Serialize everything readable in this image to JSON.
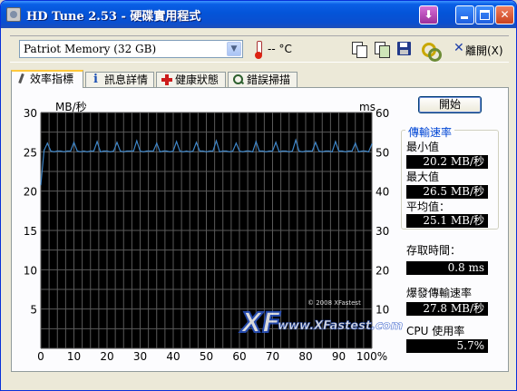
{
  "window": {
    "title": "HD Tune 2.53 - 硬碟實用程式",
    "minimize_label": "_",
    "maximize_label": "□",
    "close_label": "✕",
    "download_label": "⬇"
  },
  "toolbar": {
    "drive_selected": "Patriot Memory (32 GB)",
    "temperature": "-- °C",
    "exit_label": "離開(X)"
  },
  "tabs": [
    {
      "label": "效率指標",
      "icon": "benchmark-icon"
    },
    {
      "label": "訊息詳情",
      "icon": "info-icon"
    },
    {
      "label": "健康狀態",
      "icon": "health-cross-icon"
    },
    {
      "label": "錯誤掃描",
      "icon": "magnifier-icon"
    }
  ],
  "start_button": "開始",
  "transfer": {
    "group_label": "傳輸速率",
    "min_label": "最小值",
    "min_value": "20.2 MB/秒",
    "max_label": "最大值",
    "max_value": "26.5 MB/秒",
    "avg_label": "平均值：",
    "avg_value": "25.1 MB/秒"
  },
  "access_time": {
    "label": "存取時間：",
    "value": "0.8 ms"
  },
  "burst_rate": {
    "label": "爆發傳輸速率",
    "value": "27.8 MB/秒"
  },
  "cpu_usage": {
    "label": "CPU 使用率",
    "value": "5.7%"
  },
  "watermark": {
    "logo": "XF",
    "copyright": "© 2008 XFastest",
    "url": "www.XFastest.com"
  },
  "colors": {
    "chart_bg": "#000000",
    "grid": "#5a5a5a",
    "series": "#3f86c8",
    "accent_label": "#0046d5"
  },
  "chart_data": {
    "type": "line",
    "ylabel_left": "MB/秒",
    "ylabel_right": "ms",
    "ylim_left": [
      0,
      30
    ],
    "ylim_right": [
      0,
      60
    ],
    "yticks_left": [
      5,
      10,
      15,
      20,
      25,
      30
    ],
    "yticks_right": [
      10,
      20,
      30,
      40,
      50,
      60
    ],
    "xticks": [
      "0",
      "10",
      "20",
      "30",
      "40",
      "50",
      "60",
      "70",
      "80",
      "90",
      "100%"
    ],
    "xlim": [
      0,
      100
    ],
    "grid": true,
    "series": [
      {
        "values": [
          20.8,
          25.2,
          26.1,
          25.1,
          25.0,
          25.1,
          25.1,
          25.0,
          25.1,
          25.1,
          26.2,
          25.1,
          25.0,
          25.1,
          25.0,
          25.1,
          25.1,
          26.3,
          25.0,
          25.1,
          25.1,
          25.0,
          25.1,
          26.2,
          25.1,
          25.0,
          25.1,
          25.1,
          25.1,
          26.4,
          25.1,
          25.0,
          25.1,
          25.1,
          25.1,
          26.1,
          25.0,
          25.1,
          25.1,
          25.0,
          25.1,
          26.3,
          25.1,
          25.0,
          25.1,
          25.0,
          25.1,
          26.2,
          25.1,
          25.1,
          25.0,
          25.1,
          25.1,
          26.4,
          25.0,
          25.1,
          25.1,
          25.0,
          25.1,
          26.1,
          25.1,
          25.0,
          25.1,
          25.1,
          25.0,
          26.3,
          25.1,
          25.1,
          25.0,
          25.1,
          25.1,
          26.2,
          25.0,
          25.1,
          25.1,
          25.0,
          25.1,
          26.5,
          25.1,
          25.0,
          25.1,
          25.1,
          25.1,
          26.2,
          25.1,
          25.0,
          25.1,
          25.1,
          25.0,
          26.3,
          25.1,
          25.1,
          25.0,
          25.1,
          25.1,
          26.1,
          25.0,
          25.1,
          25.1,
          25.0,
          26.0
        ]
      }
    ]
  }
}
